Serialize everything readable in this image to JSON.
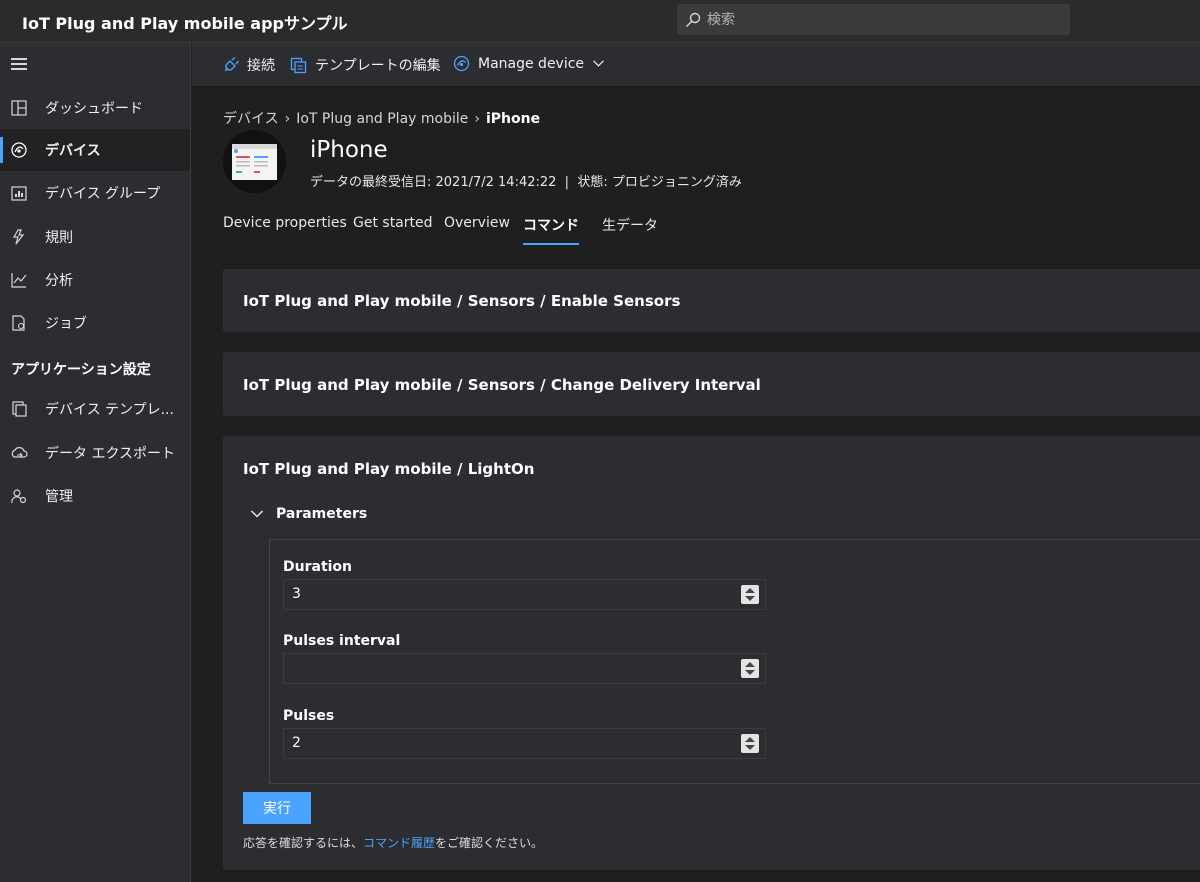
{
  "app": {
    "title": "IoT Plug and Play mobile appサンプル"
  },
  "search": {
    "placeholder": "検索"
  },
  "sidebar": {
    "items": [
      {
        "label": "ダッシュボード",
        "icon": "dashboard-icon"
      },
      {
        "label": "デバイス",
        "icon": "device-icon",
        "active": true
      },
      {
        "label": "デバイス グループ",
        "icon": "device-group-icon"
      },
      {
        "label": "規則",
        "icon": "rules-icon"
      },
      {
        "label": "分析",
        "icon": "analytics-icon"
      },
      {
        "label": "ジョブ",
        "icon": "jobs-icon"
      }
    ],
    "section_title": "アプリケーション設定",
    "settings_items": [
      {
        "label": "デバイス テンプレ...",
        "icon": "device-template-icon"
      },
      {
        "label": "データ エクスポート",
        "icon": "data-export-icon"
      },
      {
        "label": "管理",
        "icon": "admin-icon"
      }
    ]
  },
  "commandbar": {
    "connect_label": "接続",
    "edit_template_label": "テンプレートの編集",
    "manage_device_label": "Manage device"
  },
  "breadcrumb": {
    "items": [
      "デバイス",
      "IoT Plug and Play mobile",
      "iPhone"
    ]
  },
  "device": {
    "name": "iPhone",
    "meta": "データの最終受信日: 2021/7/2 14:42:22  |  状態: プロビジョニング済み"
  },
  "tabs": [
    {
      "label": "Device properties"
    },
    {
      "label": "Get started"
    },
    {
      "label": "Overview"
    },
    {
      "label": "コマンド",
      "active": true
    },
    {
      "label": "生データ"
    }
  ],
  "commands": [
    {
      "title": "IoT Plug and Play mobile / Sensors / Enable Sensors"
    },
    {
      "title": "IoT Plug and Play mobile / Sensors / Change Delivery Interval"
    },
    {
      "title": "IoT Plug and Play mobile / LightOn"
    }
  ],
  "lighton": {
    "parameters_label": "Parameters",
    "fields": [
      {
        "label": "Duration",
        "value": "3"
      },
      {
        "label": "Pulses interval",
        "value": ""
      },
      {
        "label": "Pulses",
        "value": "2"
      }
    ],
    "run_label": "実行",
    "hint_prefix": "応答を確認するには、",
    "hint_link": "コマンド履歴",
    "hint_suffix": "をご確認ください。"
  },
  "colors": {
    "accent": "#4aa3ff",
    "background": "#1f1f1f",
    "panel": "#2b2d30"
  }
}
